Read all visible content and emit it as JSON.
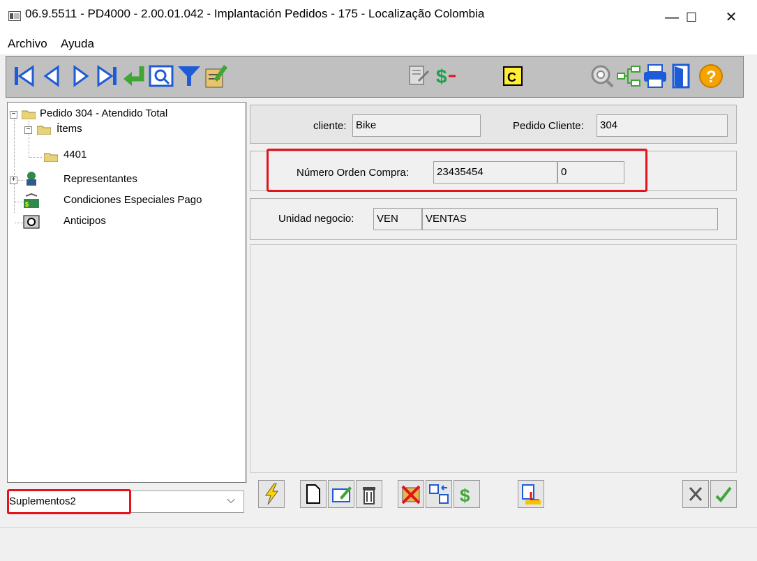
{
  "window": {
    "title": "06.9.5511 - PD4000 - 2.00.01.042 - Implantación Pedidos - 175 - Localização Colombia",
    "minimize": "—",
    "maximize": "☐",
    "close": "✕"
  },
  "menu": {
    "items": [
      "Archivo",
      "Ayuda"
    ]
  },
  "toolbar": {
    "icons": [
      "first-record-icon",
      "previous-record-icon",
      "next-record-icon",
      "last-record-icon",
      "goto-icon",
      "search-icon",
      "filter-icon",
      "edit-document-icon",
      "notes-icon",
      "currency-icon",
      "copy-icon",
      "magnifier-icon",
      "tree-structure-icon",
      "print-icon",
      "exit-door-icon",
      "help-icon"
    ]
  },
  "tree": {
    "root": "Pedido 304 - Atendido Total",
    "items_folder": "Ítems",
    "item": "4401",
    "representantes": "Representantes",
    "condiciones": "Condiciones Especiales Pago",
    "anticipos": "Anticipos",
    "expand_plus": "+",
    "collapse_minus": "−"
  },
  "header": {
    "cliente_label": "cliente:",
    "cliente_value": "Bike",
    "pedido_cliente_label": "Pedido Cliente:",
    "pedido_cliente_value": "304"
  },
  "orden": {
    "label": "Número Orden Compra:",
    "value": "23435454",
    "value2": "0"
  },
  "unidad": {
    "label": "Unidad negocio:",
    "code": "VEN",
    "name": "VENTAS"
  },
  "combo": {
    "value": "Suplementos2",
    "arrow": "⌵"
  },
  "bottom_buttons": [
    "execute-icon",
    "new-document-icon",
    "edit-icon",
    "delete-icon",
    "cancel-item-icon",
    "transfer-icon",
    "money-icon",
    "import-icon",
    "cancel-icon",
    "confirm-icon"
  ],
  "colors": {
    "highlight": "#e2131b",
    "toolbar_bg": "#c0c0c0",
    "icon_blue": "#1e5bd6",
    "icon_green": "#3fa535"
  }
}
